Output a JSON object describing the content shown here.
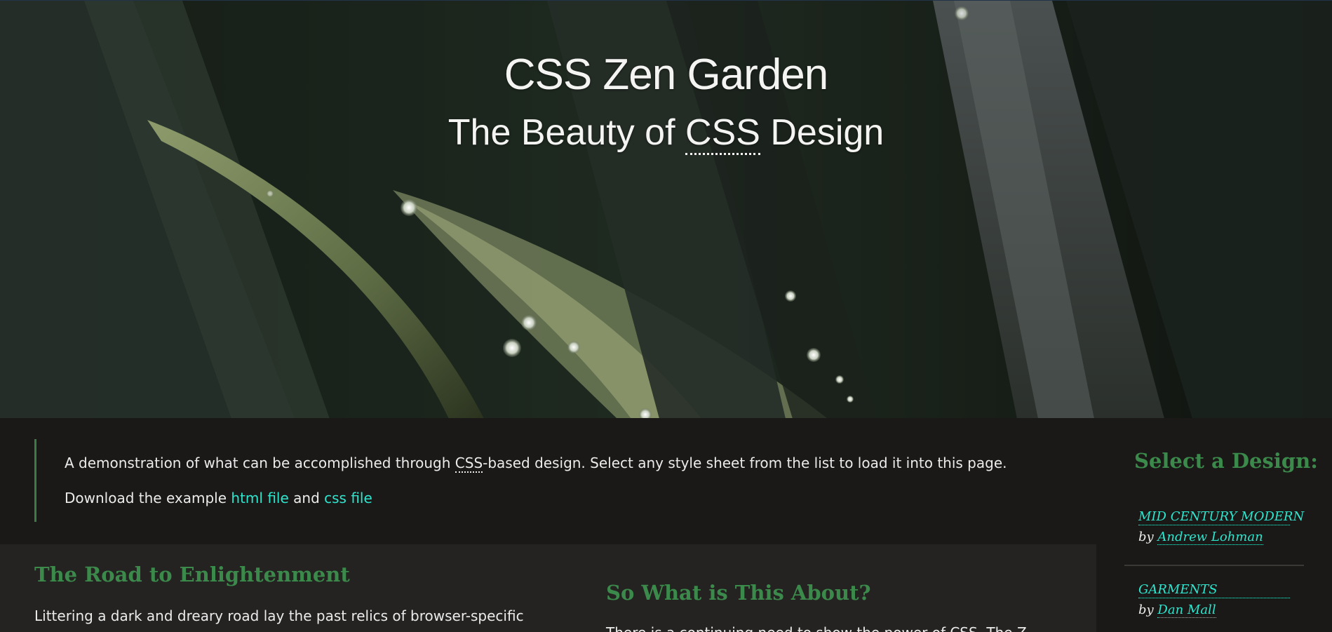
{
  "header": {
    "title": "CSS Zen Garden",
    "subtitle_before": "The Beauty of ",
    "subtitle_abbr": "CSS",
    "subtitle_after": " Design"
  },
  "preamble": {
    "line1_before": "A demonstration of what can be accomplished through ",
    "line1_abbr": "CSS",
    "line1_after": "-based design. Select any style sheet from the list to load it into this page.",
    "line2_before": "Download the example ",
    "html_link": "html file",
    "line2_and": " and ",
    "css_link": "css file"
  },
  "main": {
    "section1_heading": "The Road to Enlightenment",
    "section1_text": "Littering a dark and dreary road lay the past relics of browser-specific",
    "section2_heading": "So What is This About?",
    "section2_text": "There is a continuing need to show the power of CSS. The Z"
  },
  "sidebar": {
    "heading": "Select a Design:",
    "by_label": "by ",
    "designs": [
      {
        "name": "MID CENTURY MODERN",
        "author": "Andrew Lohman"
      },
      {
        "name": "GARMENTS",
        "author": "Dan Mall"
      }
    ]
  },
  "colors": {
    "accent_green": "#3b8a4b",
    "link_cyan": "#2ee5ce",
    "page_bg": "#1a1917",
    "content_bg": "#242321"
  }
}
